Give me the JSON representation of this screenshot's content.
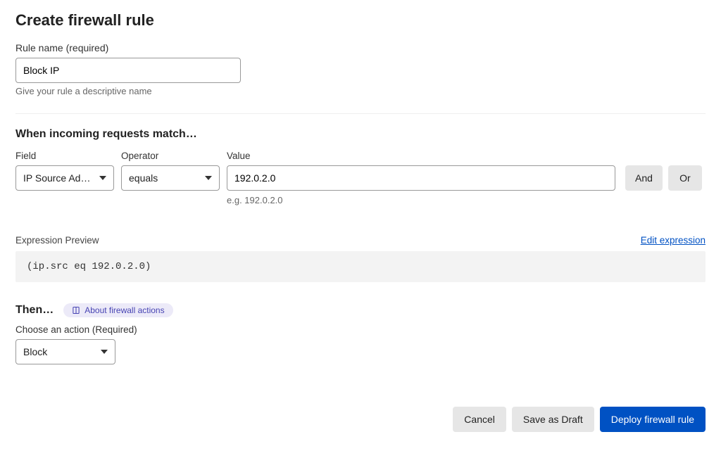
{
  "page": {
    "title": "Create firewall rule"
  },
  "rule_name": {
    "label": "Rule name (required)",
    "value": "Block IP",
    "helper": "Give your rule a descriptive name"
  },
  "match": {
    "heading": "When incoming requests match…",
    "field_label": "Field",
    "operator_label": "Operator",
    "value_label": "Value",
    "fields": [
      {
        "field": "IP Source Addr…",
        "operator": "equals",
        "value": "192.0.2.0",
        "hint": "e.g. 192.0.2.0"
      }
    ],
    "and_label": "And",
    "or_label": "Or"
  },
  "preview": {
    "title": "Expression Preview",
    "edit_label": "Edit expression",
    "expression": "(ip.src eq 192.0.2.0)"
  },
  "then": {
    "heading": "Then…",
    "pill_label": "About firewall actions",
    "action_label": "Choose an action (Required)",
    "action_value": "Block"
  },
  "footer": {
    "cancel": "Cancel",
    "save_draft": "Save as Draft",
    "deploy": "Deploy firewall rule"
  }
}
